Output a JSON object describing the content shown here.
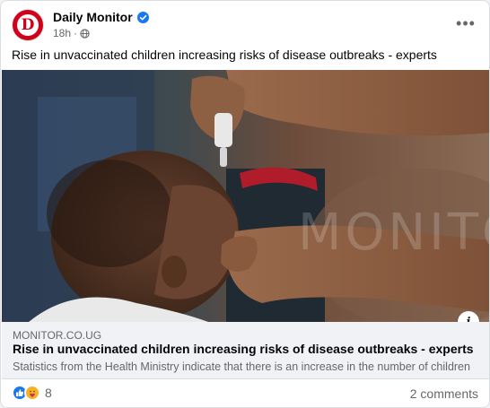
{
  "post": {
    "page_name": "Daily Monitor",
    "avatar_letter": "D",
    "time": "18h",
    "dot": "·",
    "more_label": "•••",
    "text": "Rise in unvaccinated children increasing risks of disease outbreaks - experts"
  },
  "link": {
    "watermark": "MONITOR",
    "info_label": "i",
    "domain": "MONITOR.CO.UG",
    "title": "Rise in unvaccinated children increasing risks of disease outbreaks - experts",
    "description": "Statistics from the Health Ministry indicate that there is an increase in the number of children ..."
  },
  "footer": {
    "reaction_count": "8",
    "comments": "2 comments"
  },
  "colors": {
    "brand_red": "#d0021b",
    "facebook_blue": "#1877f2",
    "secondary_text": "#65676b"
  },
  "icons": [
    "verified-badge-icon",
    "globe-icon",
    "more-icon",
    "info-icon",
    "like-reaction-icon",
    "care-reaction-icon"
  ]
}
